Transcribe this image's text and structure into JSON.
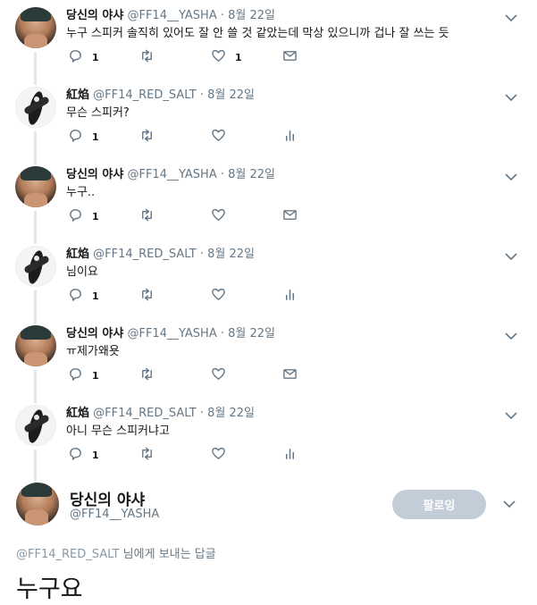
{
  "thread": [
    {
      "name": "당신의 야샤",
      "handle": "@FF14__YASHA",
      "dot": "·",
      "date": "8월 22일",
      "text": "누구 스피커 솔직히 있어도 잘 안 쓸 것 같았는데 막상 있으니까 겁나 잘 쓰는 듯",
      "reply_count": "1",
      "retweet_count": "",
      "like_count": "1",
      "avatar": "yasha",
      "extra_icon": "mail-icon"
    },
    {
      "name": "紅焰",
      "handle": "@FF14_RED_SALT",
      "dot": "·",
      "date": "8월 22일",
      "text": "무슨 스피커?",
      "reply_count": "1",
      "retweet_count": "",
      "like_count": "",
      "avatar": "salt",
      "extra_icon": "analytics-icon"
    },
    {
      "name": "당신의 야샤",
      "handle": "@FF14__YASHA",
      "dot": "·",
      "date": "8월 22일",
      "text": "누구..",
      "reply_count": "1",
      "retweet_count": "",
      "like_count": "",
      "avatar": "yasha",
      "extra_icon": "mail-icon"
    },
    {
      "name": "紅焰",
      "handle": "@FF14_RED_SALT",
      "dot": "·",
      "date": "8월 22일",
      "text": "님이요",
      "reply_count": "1",
      "retweet_count": "",
      "like_count": "",
      "avatar": "salt",
      "extra_icon": "analytics-icon"
    },
    {
      "name": "당신의 야샤",
      "handle": "@FF14__YASHA",
      "dot": "·",
      "date": "8월 22일",
      "text": "ㅠ제가왜욧",
      "reply_count": "1",
      "retweet_count": "",
      "like_count": "",
      "avatar": "yasha",
      "extra_icon": "mail-icon"
    },
    {
      "name": "紅焰",
      "handle": "@FF14_RED_SALT",
      "dot": "·",
      "date": "8월 22일",
      "text": "아니 무슨 스피커냐고",
      "reply_count": "1",
      "retweet_count": "",
      "like_count": "",
      "avatar": "salt",
      "extra_icon": "analytics-icon"
    }
  ],
  "main_tweet": {
    "name": "당신의 야샤",
    "handle": "@FF14__YASHA",
    "follow_label": "팔로잉",
    "replying_handle": "@FF14_RED_SALT",
    "replying_suffix": " 님에게 보내는 답글",
    "text": "누구요"
  },
  "colors": {
    "accent": "#c2cdd7",
    "muted": "#657786",
    "line": "#e1e8ed"
  }
}
